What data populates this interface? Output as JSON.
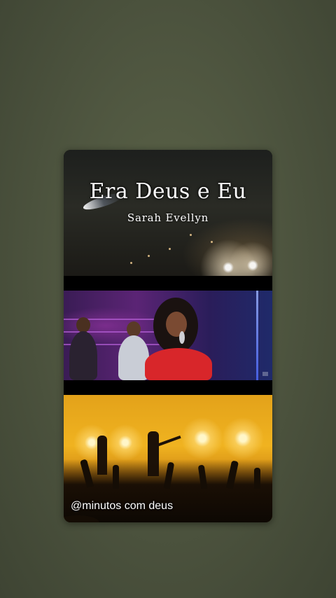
{
  "story": {
    "song_title": "Era Deus e Eu",
    "artist_name": "Sarah Evellyn",
    "account_handle": "@minutos com deus"
  },
  "colors": {
    "page_background": "#4f5640",
    "panel_purple": "#5b2475",
    "concert_gold": "#f0b320",
    "singer_dress": "#d8262a"
  },
  "icons": {
    "stage-lights": "spotlight",
    "crowd": "concert-crowd-silhouette"
  }
}
